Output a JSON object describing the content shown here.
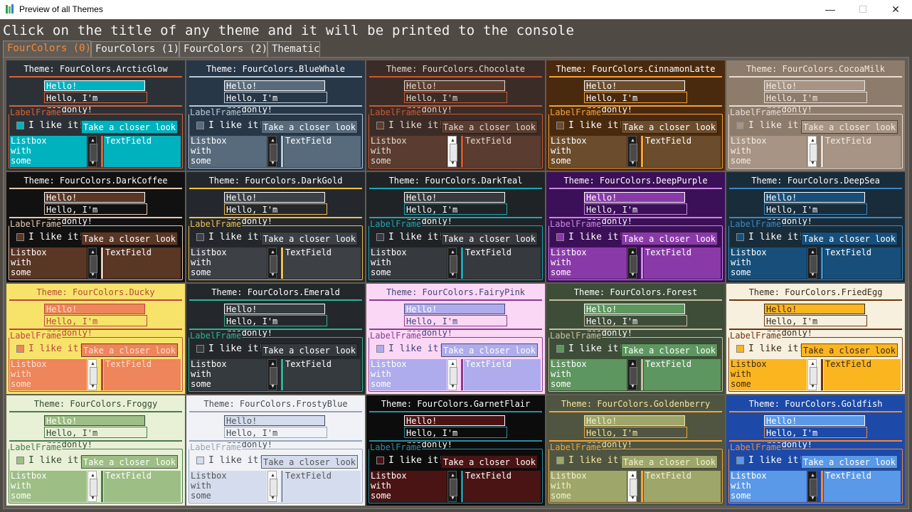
{
  "window": {
    "title": "Preview of all Themes",
    "minimize_glyph": "—",
    "maximize_glyph": "☐",
    "close_glyph": "✕",
    "app_icon": "app-icon"
  },
  "header": {
    "text": "Click on the title of any theme and it will be printed to the console"
  },
  "tabs": [
    {
      "label": "FourColors (0)",
      "active": true
    },
    {
      "label": "FourColors (1)",
      "active": false
    },
    {
      "label": "FourColors (2)",
      "active": false
    },
    {
      "label": "Thematic",
      "active": false
    }
  ],
  "card_text": {
    "input": "Hello!",
    "readonly": "Hello, I'm readonly!",
    "frame_label": "LabelFrame",
    "checkbox_label": "I like it!",
    "button": "Take a closer look",
    "listbox_lines": [
      "Listbox",
      "with",
      "some"
    ],
    "textfield": "TextField"
  },
  "themes": [
    {
      "title": "Theme: FourColors.ArcticGlow",
      "bg": "#2c3138",
      "fg": "#ffffff",
      "accent": "#00b2be",
      "accent_fg": "#ffffff",
      "sep": "#d46536",
      "field": "#00b2be",
      "field_fg": "#ffffff",
      "ro_bg": "#2c3138",
      "label": "#e55e2e"
    },
    {
      "title": "Theme: FourColors.BlueWhale",
      "bg": "#283747",
      "fg": "#ffffff",
      "accent": "#576b7c",
      "accent_fg": "#ffffff",
      "sep": "#b8c9d6",
      "field": "#576b7c",
      "field_fg": "#ffffff",
      "ro_bg": "#283747",
      "label": "#b8c9d6"
    },
    {
      "title": "Theme: FourColors.Chocolate",
      "bg": "#3b2c28",
      "fg": "#e6d8ce",
      "accent": "#5a3d30",
      "accent_fg": "#e6d8ce",
      "sep": "#c85a33",
      "field": "#5a3d30",
      "field_fg": "#e6d8ce",
      "ro_bg": "#3b2c28",
      "label": "#c85a33"
    },
    {
      "title": "Theme: FourColors.CinnamonLatte",
      "bg": "#4a2a0e",
      "fg": "#ffffff",
      "accent": "#6b4c2c",
      "accent_fg": "#ffffff",
      "sep": "#f5a33a",
      "field": "#6b4c2c",
      "field_fg": "#ffffff",
      "ro_bg": "#4a2a0e",
      "label": "#f5a33a"
    },
    {
      "title": "Theme: FourColors.CocoaMilk",
      "bg": "#8d7b6c",
      "fg": "#f2ebe3",
      "accent": "#a79484",
      "accent_fg": "#f2ebe3",
      "sep": "#e8ddd2",
      "field": "#a79484",
      "field_fg": "#f2ebe3",
      "ro_bg": "#8d7b6c",
      "label": "#e8ddd2"
    },
    {
      "title": "Theme: FourColors.DarkCoffee",
      "bg": "#111111",
      "fg": "#ffffff",
      "accent": "#5a3625",
      "accent_fg": "#ffffff",
      "sep": "#e6c9b3",
      "field": "#5a3625",
      "field_fg": "#ffffff",
      "ro_bg": "#111111",
      "label": "#e6c9b3"
    },
    {
      "title": "Theme: FourColors.DarkGold",
      "bg": "#24282c",
      "fg": "#ffffff",
      "accent": "#3d4146",
      "accent_fg": "#ffffff",
      "sep": "#f0c050",
      "field": "#3d4146",
      "field_fg": "#ffffff",
      "ro_bg": "#24282c",
      "label": "#f0c050"
    },
    {
      "title": "Theme: FourColors.DarkTeal",
      "bg": "#1f2326",
      "fg": "#ffffff",
      "accent": "#363a3e",
      "accent_fg": "#ffffff",
      "sep": "#1ea6b5",
      "field": "#363a3e",
      "field_fg": "#ffffff",
      "ro_bg": "#1f2326",
      "label": "#1ea6b5"
    },
    {
      "title": "Theme: FourColors.DeepPurple",
      "bg": "#3c1058",
      "fg": "#ffffff",
      "accent": "#8a3aa8",
      "accent_fg": "#ffffff",
      "sep": "#c88ae0",
      "field": "#8a3aa8",
      "field_fg": "#ffffff",
      "ro_bg": "#3c1058",
      "label": "#c88ae0"
    },
    {
      "title": "Theme: FourColors.DeepSea",
      "bg": "#192c3a",
      "fg": "#ffffff",
      "accent": "#174f7a",
      "accent_fg": "#ffffff",
      "sep": "#3b8ac4",
      "field": "#174f7a",
      "field_fg": "#ffffff",
      "ro_bg": "#192c3a",
      "label": "#3b8ac4"
    },
    {
      "title": "Theme: FourColors.Ducky",
      "bg": "#f7e36a",
      "fg": "#b8463d",
      "accent": "#ee855b",
      "accent_fg": "#ffe0d0",
      "sep": "#b8463d",
      "field": "#ee855b",
      "field_fg": "#ffe0d0",
      "ro_bg": "#f7e36a",
      "label": "#b8463d"
    },
    {
      "title": "Theme: FourColors.Emerald",
      "bg": "#24282c",
      "fg": "#ffffff",
      "accent": "#353a3f",
      "accent_fg": "#ffffff",
      "sep": "#2fb394",
      "field": "#353a3f",
      "field_fg": "#ffffff",
      "ro_bg": "#24282c",
      "label": "#2fb394"
    },
    {
      "title": "Theme: FourColors.FairyPink",
      "bg": "#fbd7f6",
      "fg": "#43437a",
      "accent": "#aeacec",
      "accent_fg": "#ffffff",
      "sep": "#8b3a8f",
      "field": "#aeacec",
      "field_fg": "#ffffff",
      "ro_bg": "#fbd7f6",
      "label": "#8b3a8f"
    },
    {
      "title": "Theme: FourColors.Forest",
      "bg": "#3e4d38",
      "fg": "#ffffff",
      "accent": "#5e9660",
      "accent_fg": "#ffffff",
      "sep": "#c8c0a0",
      "field": "#5e9660",
      "field_fg": "#ffffff",
      "ro_bg": "#3e4d38",
      "label": "#c8c0a0"
    },
    {
      "title": "Theme: FourColors.FriedEgg",
      "bg": "#f7f0df",
      "fg": "#3a2a1a",
      "accent": "#fbb51f",
      "accent_fg": "#3a2a1a",
      "sep": "#6b3410",
      "field": "#fbb51f",
      "field_fg": "#3a2a1a",
      "ro_bg": "#f7f0df",
      "label": "#6b3410"
    },
    {
      "title": "Theme: FourColors.Froggy",
      "bg": "#e8f0d6",
      "fg": "#2f4a30",
      "accent": "#9dbe85",
      "accent_fg": "#ffffff",
      "sep": "#4a7a50",
      "field": "#9dbe85",
      "field_fg": "#ffffff",
      "ro_bg": "#e8f0d6",
      "label": "#4a7a50"
    },
    {
      "title": "Theme: FourColors.FrostyBlue",
      "bg": "#f0f2f6",
      "fg": "#444a55",
      "accent": "#d4dced",
      "accent_fg": "#555555",
      "sep": "#98a4b8",
      "field": "#d4dced",
      "field_fg": "#555555",
      "ro_bg": "#f0f2f6",
      "label": "#98a4b8"
    },
    {
      "title": "Theme: FourColors.GarnetFlair",
      "bg": "#0c0c0c",
      "fg": "#ffffff",
      "accent": "#4a1414",
      "accent_fg": "#ffffff",
      "sep": "#2a8fa0",
      "field": "#4a1414",
      "field_fg": "#ffffff",
      "ro_bg": "#0c0c0c",
      "label": "#2a8fa0"
    },
    {
      "title": "Theme: FourColors.Goldenberry",
      "bg": "#4f5540",
      "fg": "#f5e6a0",
      "accent": "#9ea66a",
      "accent_fg": "#f5f0d0",
      "sep": "#f5a33a",
      "field": "#9ea66a",
      "field_fg": "#f5f0d0",
      "ro_bg": "#4f5540",
      "label": "#f5a33a"
    },
    {
      "title": "Theme: FourColors.Goldfish",
      "bg": "#1d4aa8",
      "fg": "#ffffff",
      "accent": "#5a98e8",
      "accent_fg": "#ffffff",
      "sep": "#f08a3a",
      "field": "#5a98e8",
      "field_fg": "#ffffff",
      "ro_bg": "#1d4aa8",
      "label": "#f08a3a"
    }
  ]
}
